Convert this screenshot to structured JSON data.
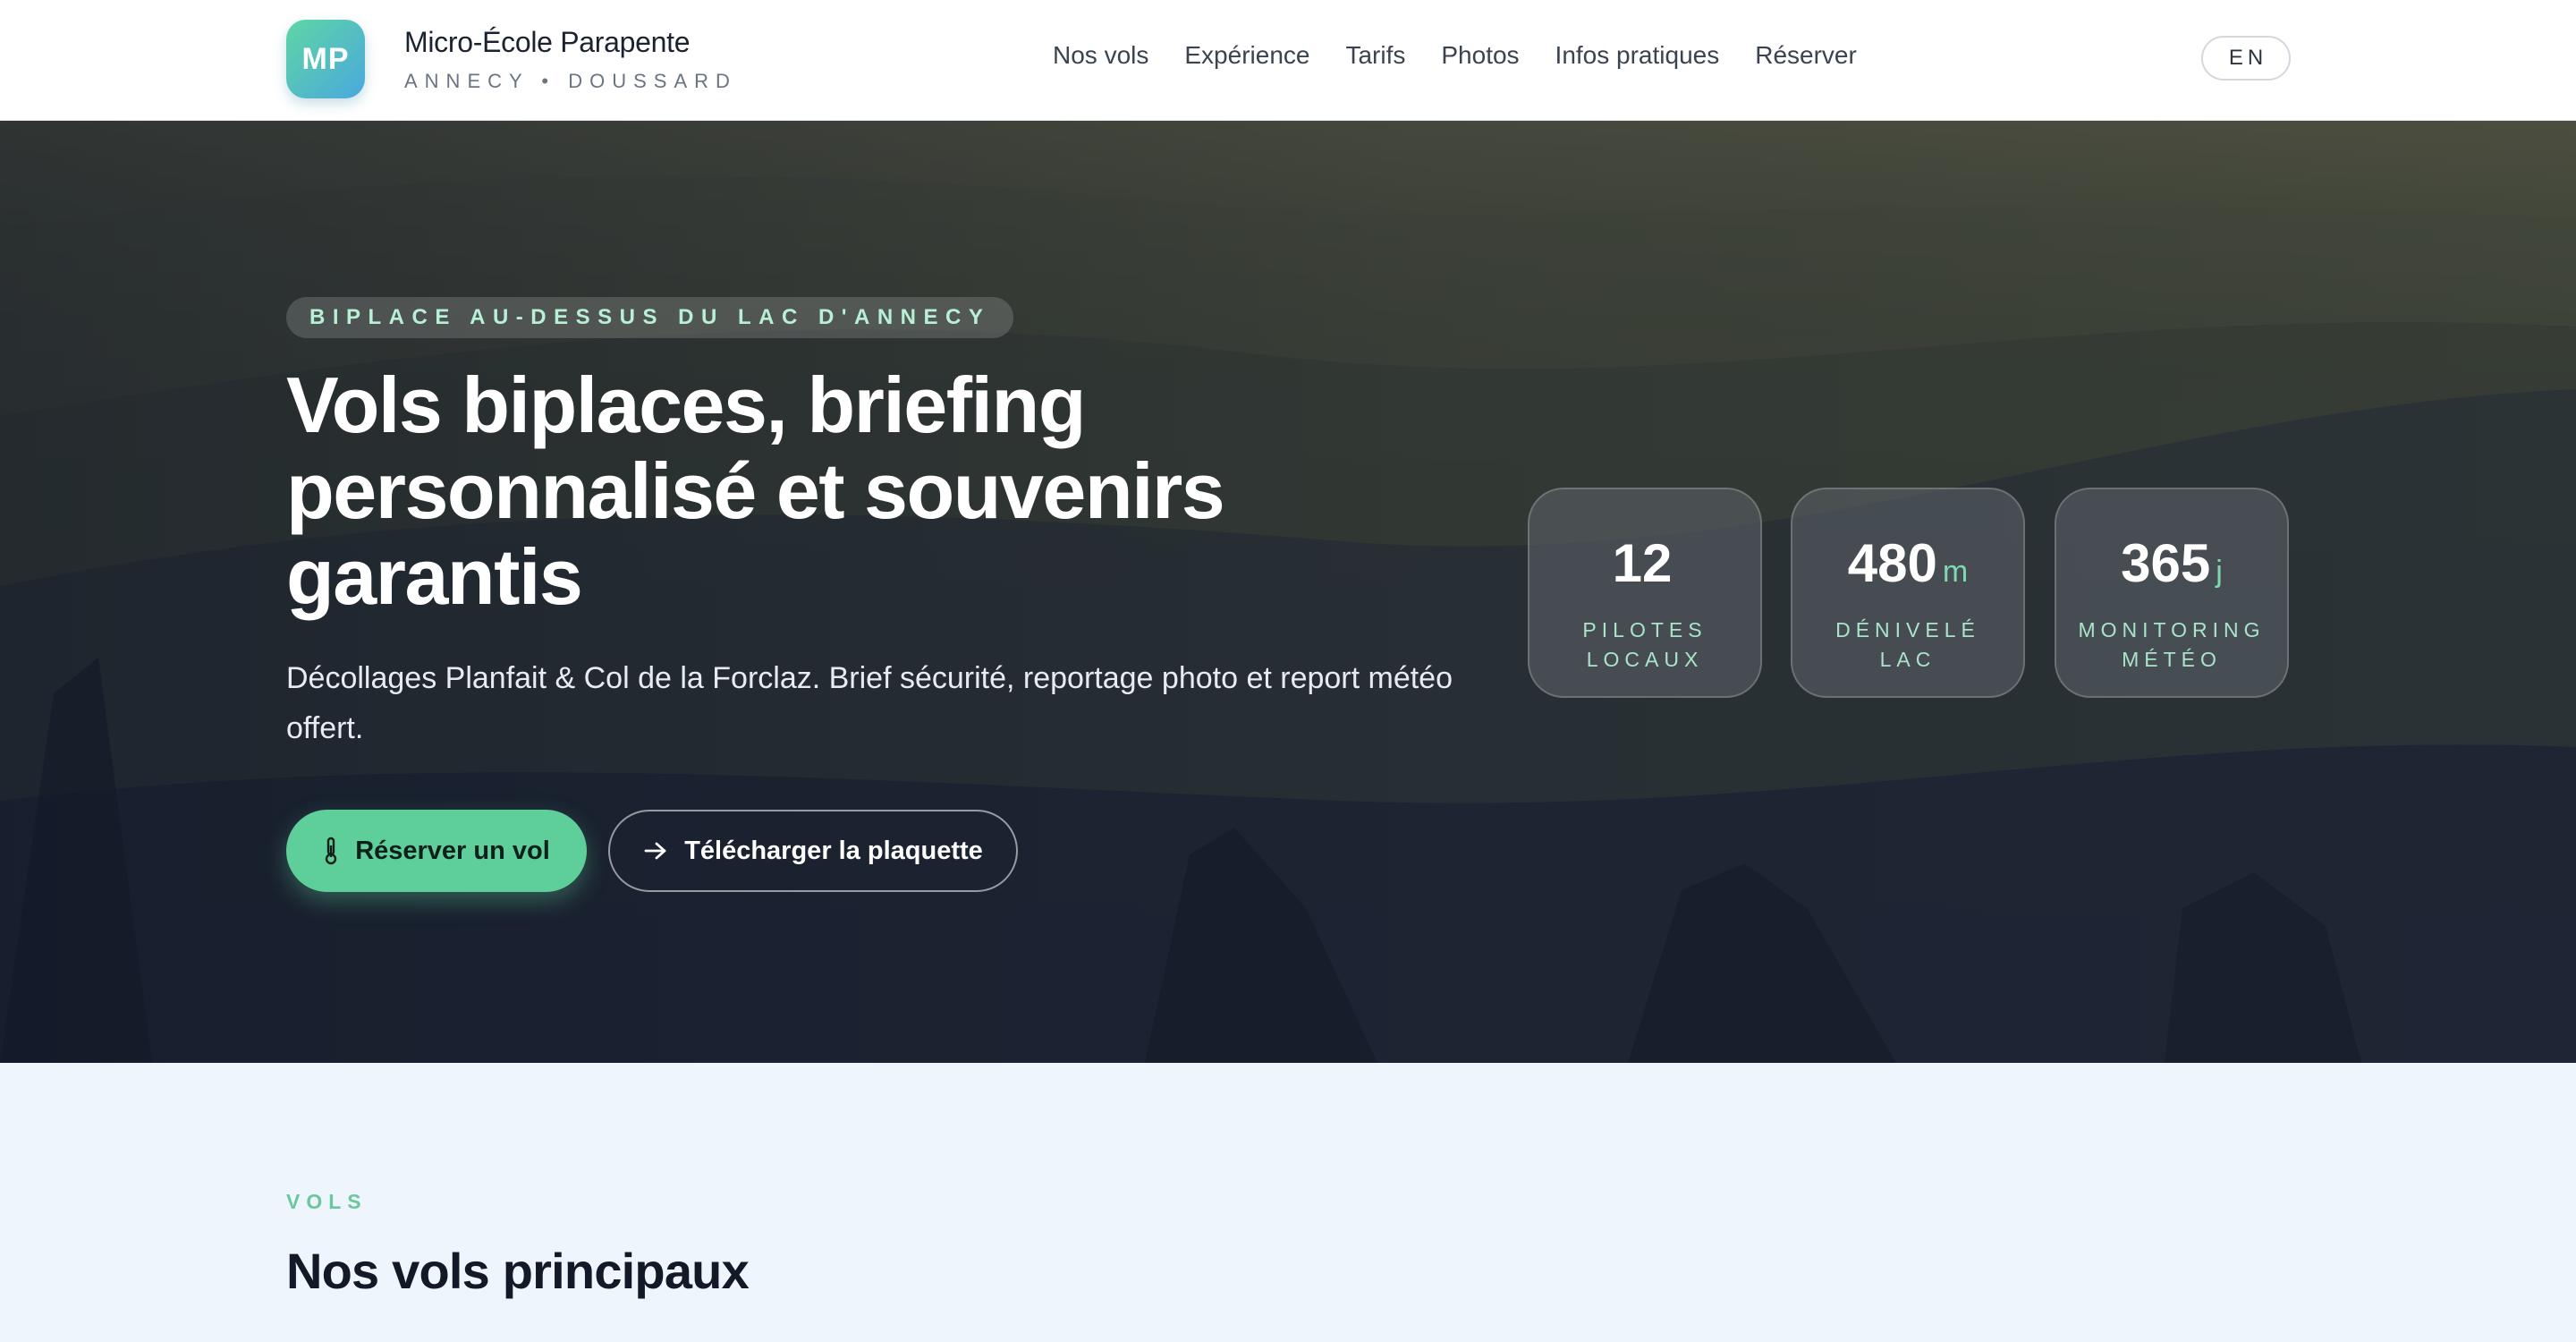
{
  "header": {
    "logo_initials": "MP",
    "brand_name": "Micro-École Parapente",
    "brand_subtitle": "ANNECY • DOUSSARD",
    "nav": [
      {
        "label": "Nos vols"
      },
      {
        "label": "Expérience"
      },
      {
        "label": "Tarifs"
      },
      {
        "label": "Photos"
      },
      {
        "label": "Infos pratiques"
      },
      {
        "label": "Réserver"
      }
    ],
    "language_button": "EN"
  },
  "hero": {
    "eyebrow": "BIPLACE AU-DESSUS DU LAC D'ANNECY",
    "title": "Vols biplaces, briefing personnalisé et souvenirs garantis",
    "lead": "Décollages Planfait & Col de la Forclaz. Brief sécurité, reportage photo et report météo offert.",
    "primary_button": "Réserver un vol",
    "primary_icon": "thermometer-icon",
    "secondary_button": "Télécharger la plaquette",
    "secondary_icon": "arrow-right-icon",
    "stats": [
      {
        "value": "12",
        "unit": "",
        "label": "PILOTES LOCAUX"
      },
      {
        "value": "480",
        "unit": "m",
        "label": "DÉNIVELÉ LAC"
      },
      {
        "value": "365",
        "unit": "j",
        "label": "MONITORING MÉTÉO"
      }
    ]
  },
  "section": {
    "eyebrow": "VOLS",
    "title": "Nos vols principaux"
  },
  "colors": {
    "accent": "#5ecf9a",
    "hero_dark": "#181f33",
    "page_bg": "#eef5fd"
  }
}
